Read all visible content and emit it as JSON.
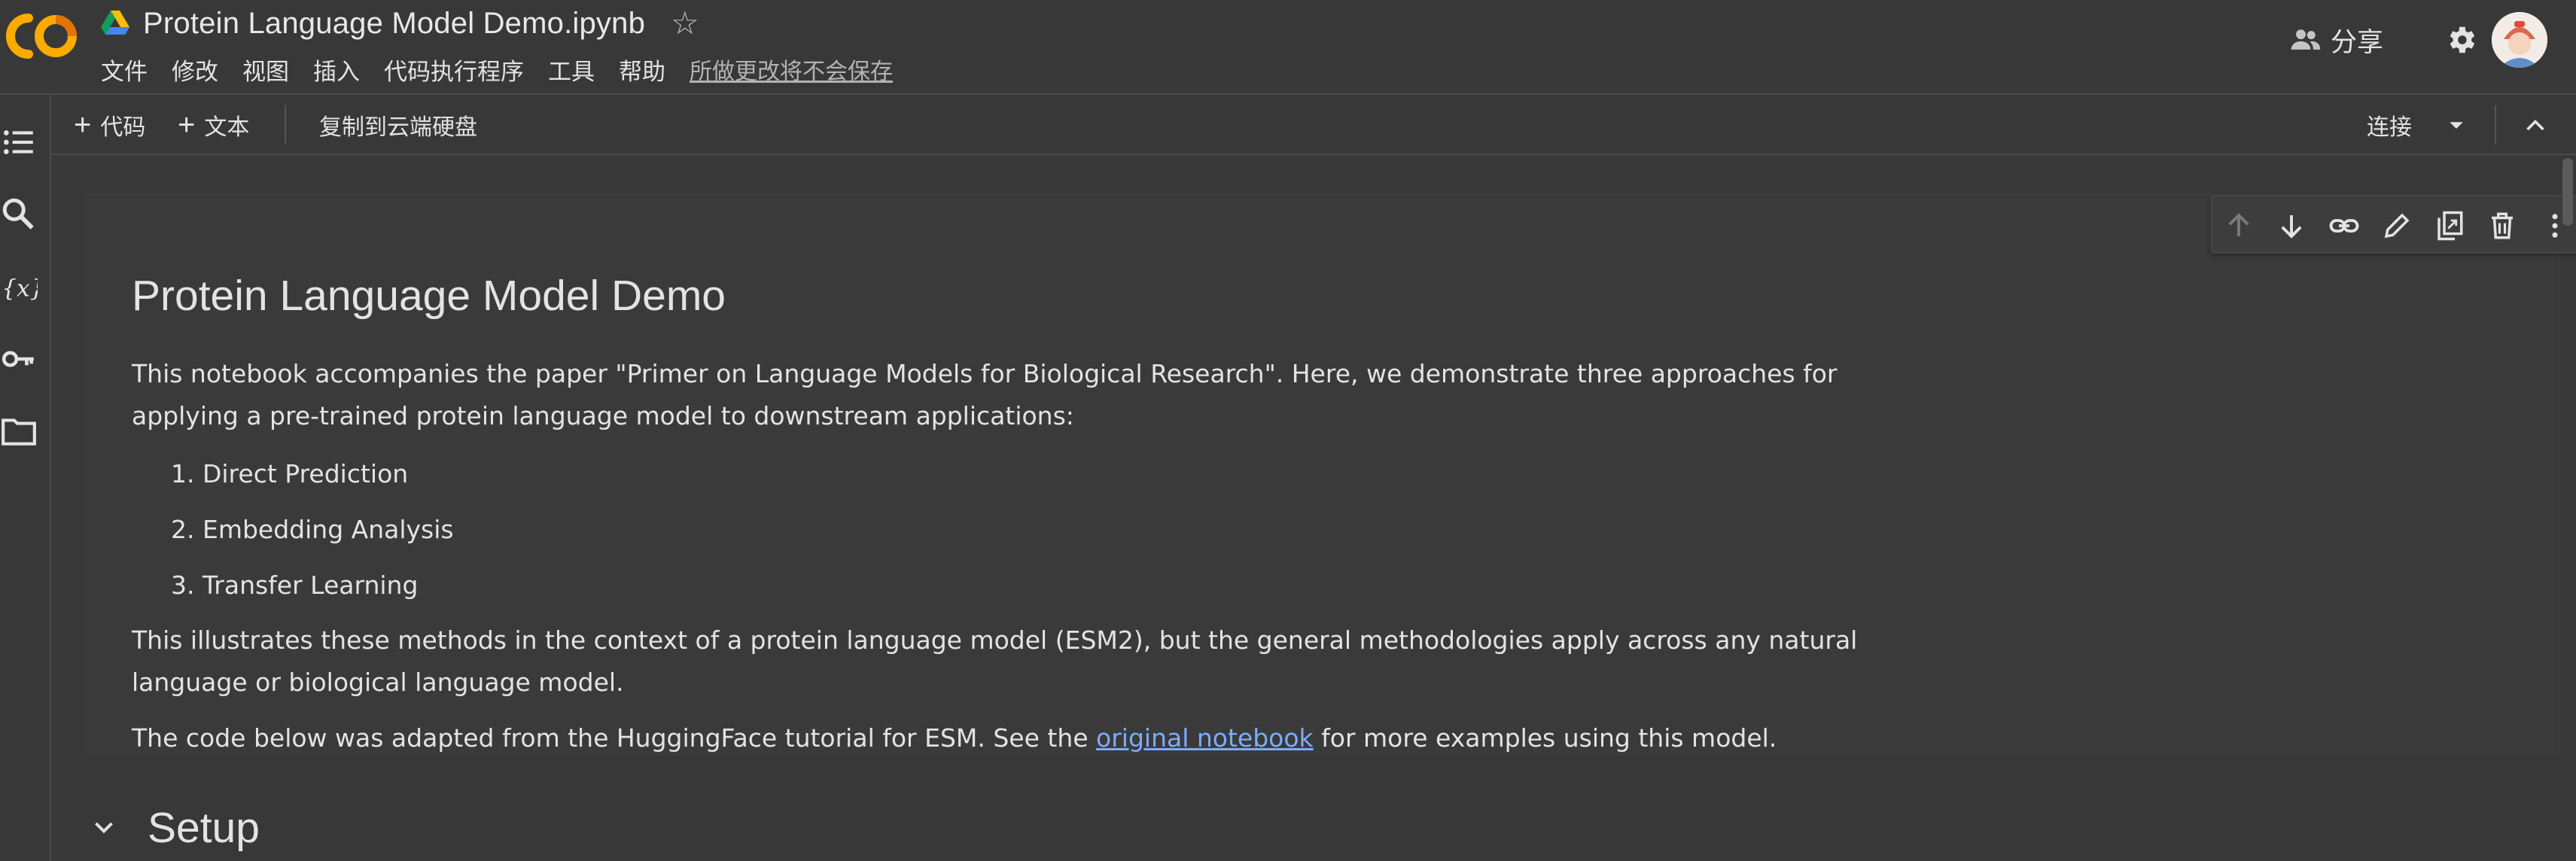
{
  "header": {
    "title": "Protein Language Model Demo.ipynb",
    "menu": [
      "文件",
      "修改",
      "视图",
      "插入",
      "代码执行程序",
      "工具",
      "帮助"
    ],
    "unsaved_notice": "所做更改将不会保存",
    "share_label": "分享"
  },
  "toolbar": {
    "add_code": "代码",
    "add_text": "文本",
    "copy_to_drive": "复制到云端硬盘",
    "connect": "连接"
  },
  "sidebar": {
    "icons": [
      "toc-icon",
      "search-icon",
      "variables-icon",
      "key-icon",
      "folder-icon"
    ]
  },
  "cell": {
    "heading": "Protein Language Model Demo",
    "intro": "This notebook accompanies the paper \"Primer on Language Models for Biological Research\". Here, we demonstrate three approaches for applying a pre-trained protein language model to downstream applications:",
    "list": [
      "1. Direct Prediction",
      "2. Embedding Analysis",
      "3. Transfer Learning"
    ],
    "para2": "This illustrates these methods in the context of a protein language model (ESM2), but the general methodologies apply across any natural language or biological language model.",
    "para3_before": "The code below was adapted from the HuggingFace tutorial for ESM. See the ",
    "para3_link": "original notebook",
    "para3_after": " for more examples using this model."
  },
  "section": {
    "title": "Setup"
  },
  "colors": {
    "background": "#383838",
    "link": "#7cacf8",
    "logo_orange": "#f9ab00",
    "logo_dark_orange": "#e37400"
  }
}
